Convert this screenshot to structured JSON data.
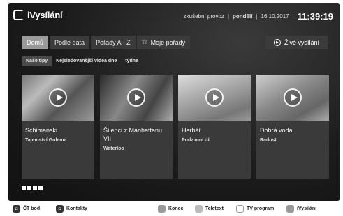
{
  "header": {
    "logo_text": "iVysílání",
    "mode": "zkušební provoz",
    "day": "pondělí",
    "date": "16.10.2017",
    "time": "11:39:19"
  },
  "nav": {
    "items": [
      {
        "label": "Domů",
        "active": true
      },
      {
        "label": "Podle data",
        "active": false
      },
      {
        "label": "Pořady A - Z",
        "active": false
      },
      {
        "label": "Moje pořady",
        "active": false,
        "icon": "star-outline-icon"
      }
    ],
    "live_label": "Živé vysílání"
  },
  "subtabs": [
    {
      "label": "Naše tipy",
      "active": true
    },
    {
      "label": "Nejsledovanější videa dne",
      "active": false
    },
    {
      "label": "týdne",
      "active": false
    }
  ],
  "cards": [
    {
      "title": "Schimanski",
      "subtitle": "Tajemství Golema"
    },
    {
      "title": "Šílenci z Manhattanu VII",
      "subtitle": "Waterloo"
    },
    {
      "title": "Herbář",
      "subtitle": "Podzimní díl"
    },
    {
      "title": "Dobrá voda",
      "subtitle": "Radost"
    }
  ],
  "pager": {
    "pages": 4
  },
  "footer": {
    "ct_bod": "ČT bod",
    "contacts": "Kontakty",
    "exit": "Konec",
    "teletext": "Teletext",
    "tv_program": "TV program",
    "ivysilani": "iVysílání"
  }
}
